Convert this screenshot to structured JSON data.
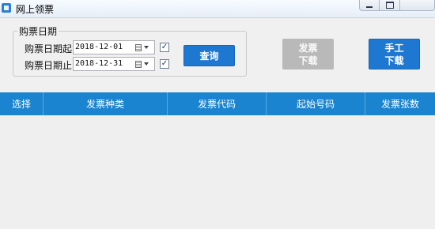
{
  "window": {
    "title": "网上领票",
    "controls": [
      "minimize",
      "maximize",
      "close"
    ]
  },
  "filter": {
    "group_label": "购票日期",
    "start": {
      "label": "购票日期起",
      "value": "2018-12-01",
      "checked": true
    },
    "end": {
      "label": "购票日期止",
      "value": "2018-12-31",
      "checked": true
    },
    "checkmark": "✓"
  },
  "buttons": {
    "query": "查询",
    "invoice_download": {
      "line1": "发票",
      "line2": "下载",
      "enabled": false
    },
    "manual_download": {
      "line1": "手工",
      "line2": "下载",
      "enabled": true
    }
  },
  "grid": {
    "columns": [
      "选择",
      "发票种类",
      "发票代码",
      "起始号码",
      "发票张数"
    ],
    "rows": []
  },
  "colors": {
    "accent": "#1e78d2",
    "header": "#1a84d0",
    "disabled": "#b9b9b9"
  }
}
